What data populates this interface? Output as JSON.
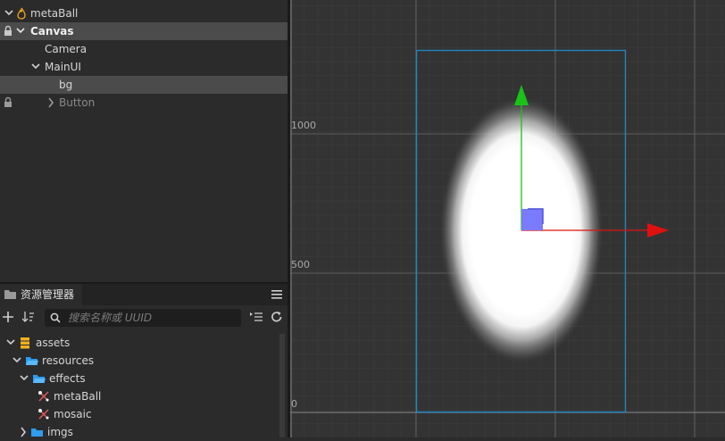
{
  "hierarchy": {
    "root": "metaBall",
    "canvas": "Canvas",
    "camera": "Camera",
    "mainui": "MainUI",
    "bg": "bg",
    "button": "Button"
  },
  "assets": {
    "tab_title": "资源管理器",
    "search_placeholder": "搜索名称或 UUID",
    "items": [
      "assets",
      "resources",
      "effects",
      "metaBall",
      "mosaic",
      "imgs"
    ]
  },
  "scene": {
    "labels": [
      "1000",
      "500",
      "0"
    ]
  },
  "colors": {
    "selection": "#4b4b4b",
    "frame": "#1e88c7",
    "gizmo_y": "#19c419",
    "gizmo_x": "#e01010",
    "gizmo_box": "#7b7bff",
    "folder": "#2e9cf0",
    "asset_root": "#f2b01e"
  }
}
